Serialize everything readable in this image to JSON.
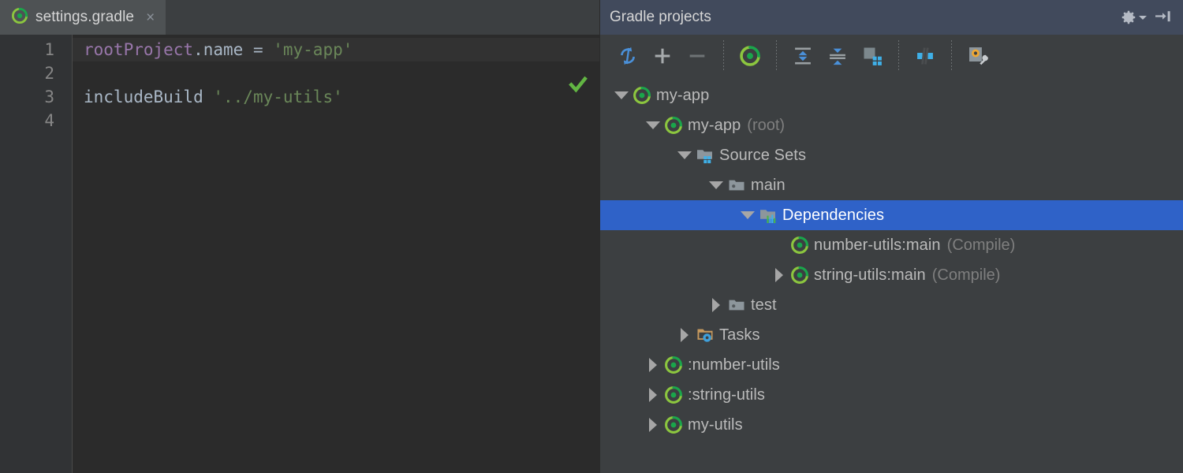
{
  "editor": {
    "tab": {
      "icon": "gradle-icon",
      "title": "settings.gradle",
      "close_label": "×"
    },
    "line_numbers": [
      "1",
      "2",
      "3",
      "4"
    ],
    "inspection_status_icon": "green-checkmark-icon",
    "code": [
      {
        "current": true,
        "tokens": [
          {
            "cls": "tok-prop",
            "text": "rootProject"
          },
          {
            "cls": "tok-field",
            "text": ".name "
          },
          {
            "cls": "tok-op",
            "text": "= "
          },
          {
            "cls": "tok-str",
            "text": "'my-app'"
          }
        ]
      },
      {
        "current": false,
        "tokens": []
      },
      {
        "current": false,
        "tokens": [
          {
            "cls": "tok-fn",
            "text": "includeBuild "
          },
          {
            "cls": "tok-str",
            "text": "'../my-utils'"
          }
        ]
      },
      {
        "current": false,
        "tokens": []
      }
    ]
  },
  "panel": {
    "title": "Gradle projects",
    "header_buttons": [
      {
        "name": "settings-gear-button",
        "icon": "gear-icon",
        "has_caret": true
      },
      {
        "name": "hide-panel-button",
        "icon": "hide-arrow-icon",
        "has_caret": false
      }
    ],
    "toolbar": [
      {
        "name": "reload-all-gradle-projects-button",
        "icon": "refresh-icon"
      },
      {
        "name": "link-gradle-project-button",
        "icon": "plus-icon"
      },
      {
        "name": "unlink-gradle-project-button",
        "icon": "minus-icon"
      },
      {
        "sep": true
      },
      {
        "name": "execute-gradle-task-button",
        "icon": "gradle-icon"
      },
      {
        "sep": true
      },
      {
        "name": "expand-all-button",
        "icon": "expand-all-icon"
      },
      {
        "name": "collapse-all-button",
        "icon": "collapse-all-icon"
      },
      {
        "name": "group-modules-button",
        "icon": "group-modules-icon"
      },
      {
        "sep": true
      },
      {
        "name": "toggle-offline-mode-button",
        "icon": "offline-mode-icon"
      },
      {
        "sep": true
      },
      {
        "name": "gradle-settings-button",
        "icon": "gradle-settings-wrench-icon"
      }
    ],
    "tree": [
      {
        "indent": 0,
        "twisty": "down",
        "icon": "gradle-icon",
        "label": "my-app",
        "sub": "",
        "selected": false
      },
      {
        "indent": 1,
        "twisty": "down",
        "icon": "gradle-icon",
        "label": "my-app",
        "sub": "(root)",
        "selected": false
      },
      {
        "indent": 2,
        "twisty": "down",
        "icon": "source-sets-icon",
        "label": "Source Sets",
        "sub": "",
        "selected": false
      },
      {
        "indent": 3,
        "twisty": "down",
        "icon": "folder-icon",
        "label": "main",
        "sub": "",
        "selected": false
      },
      {
        "indent": 4,
        "twisty": "down",
        "icon": "dependencies-icon",
        "label": "Dependencies",
        "sub": "",
        "selected": true
      },
      {
        "indent": 5,
        "twisty": "none",
        "icon": "gradle-icon",
        "label": "number-utils:main",
        "sub": "(Compile)",
        "selected": false
      },
      {
        "indent": 5,
        "twisty": "right",
        "icon": "gradle-icon",
        "label": "string-utils:main",
        "sub": "(Compile)",
        "selected": false
      },
      {
        "indent": 3,
        "twisty": "right",
        "icon": "folder-icon",
        "label": "test",
        "sub": "",
        "selected": false
      },
      {
        "indent": 2,
        "twisty": "right",
        "icon": "tasks-icon",
        "label": "Tasks",
        "sub": "",
        "selected": false
      },
      {
        "indent": 1,
        "twisty": "right",
        "icon": "gradle-icon",
        "label": ":number-utils",
        "sub": "",
        "selected": false
      },
      {
        "indent": 1,
        "twisty": "right",
        "icon": "gradle-icon",
        "label": ":string-utils",
        "sub": "",
        "selected": false
      },
      {
        "indent": 1,
        "twisty": "right",
        "icon": "gradle-icon",
        "label": "my-utils",
        "sub": "",
        "selected": false
      }
    ]
  },
  "colors": {
    "editor_bg": "#2b2b2b",
    "current_line": "#323232",
    "gutter_bg": "#313335",
    "panel_bg": "#3c3f41",
    "panel_header_bg": "#414a5c",
    "tab_active_bg": "#4e5254",
    "selection_blue": "#2f62c8",
    "gradle_green": "#6cb33f",
    "string_green": "#6a8759",
    "keyword_purple": "#9876aa",
    "text_gray": "#bbbbbb"
  }
}
